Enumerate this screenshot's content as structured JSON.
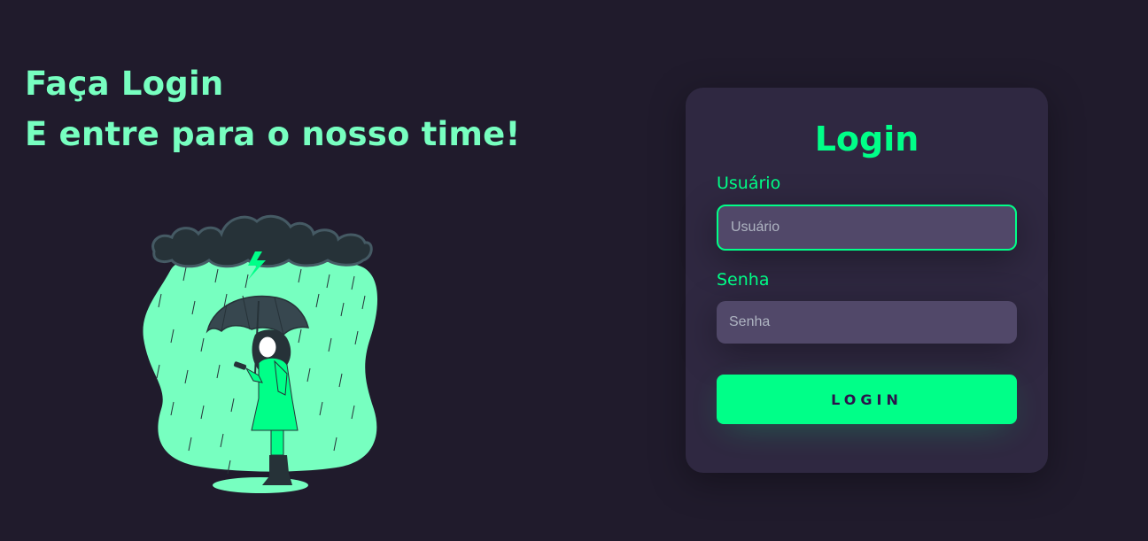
{
  "hero": {
    "line1": "Faça Login",
    "line2": "E entre para o nosso time!"
  },
  "illustration": {
    "name": "person-with-umbrella-in-rain",
    "colors": {
      "blob": "#77ffc0",
      "coat": "#00ff88",
      "cloud": "#263238",
      "umbrella": "#37474f"
    }
  },
  "login_card": {
    "title": "Login",
    "username": {
      "label": "Usuário",
      "placeholder": "Usuário",
      "value": ""
    },
    "password": {
      "label": "Senha",
      "placeholder": "Senha",
      "value": ""
    },
    "submit_label": "LOGIN"
  },
  "theme": {
    "background": "#201b2c",
    "card": "#2f2841",
    "input": "#514869",
    "accent": "#00ff88",
    "heading": "#77ffc0"
  }
}
